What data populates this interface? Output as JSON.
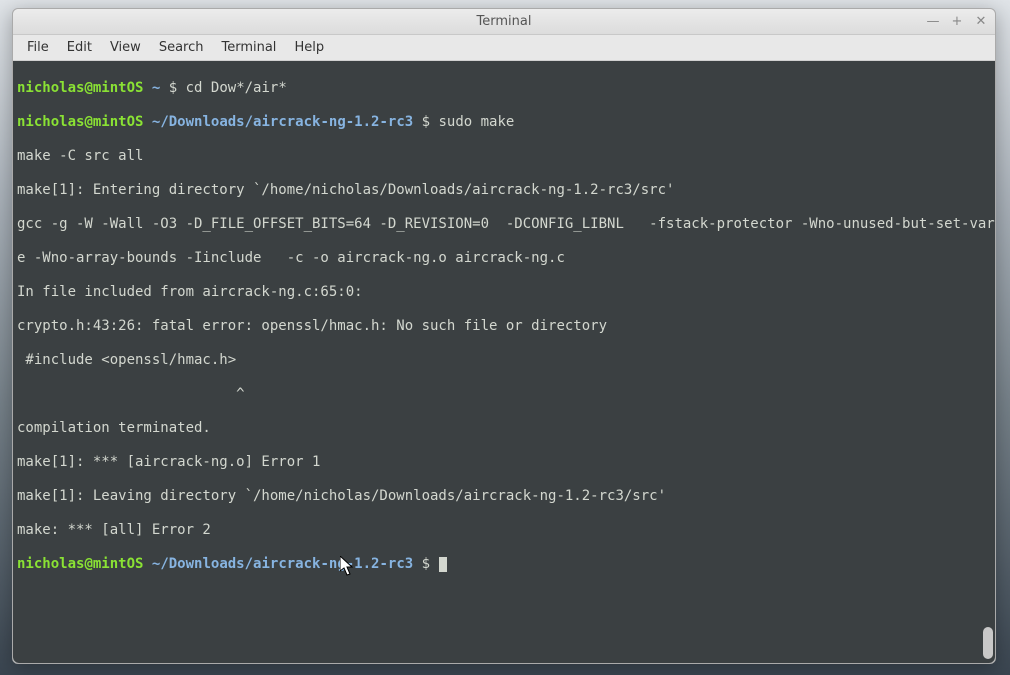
{
  "window": {
    "title": "Terminal",
    "controls": {
      "min": "—",
      "max": "+",
      "close": "✕"
    }
  },
  "menubar": {
    "file": "File",
    "edit": "Edit",
    "view": "View",
    "search": "Search",
    "terminal": "Terminal",
    "help": "Help"
  },
  "prompt": {
    "user": "nicholas",
    "at": "@",
    "host": "mintOS",
    "sep": " ",
    "path_home": "~",
    "path_rc3": "~/Downloads/aircrack-ng-1.2-rc3",
    "dollar": " $ "
  },
  "lines": {
    "cmd1": "cd Dow*/air*",
    "cmd2": "sudo make",
    "o1": "make -C src all",
    "o2": "make[1]: Entering directory `/home/nicholas/Downloads/aircrack-ng-1.2-rc3/src'",
    "o3a": "gcc -g -W -Wall -O3 -D_FILE_OFFSET_BITS=64 -D_REVISION=0  -DCONFIG_LIBNL   -fstack-protector -Wno-unused-but-set-variabl",
    "o3b": "e -Wno-array-bounds -Iinclude   -c -o aircrack-ng.o aircrack-ng.c",
    "o4": "In file included from aircrack-ng.c:65:0:",
    "o5": "crypto.h:43:26: fatal error: openssl/hmac.h: No such file or directory",
    "o6": " #include <openssl/hmac.h>",
    "o7": "                          ^",
    "o8": "compilation terminated.",
    "o9": "make[1]: *** [aircrack-ng.o] Error 1",
    "o10": "make[1]: Leaving directory `/home/nicholas/Downloads/aircrack-ng-1.2-rc3/src'",
    "o11": "make: *** [all] Error 2"
  }
}
